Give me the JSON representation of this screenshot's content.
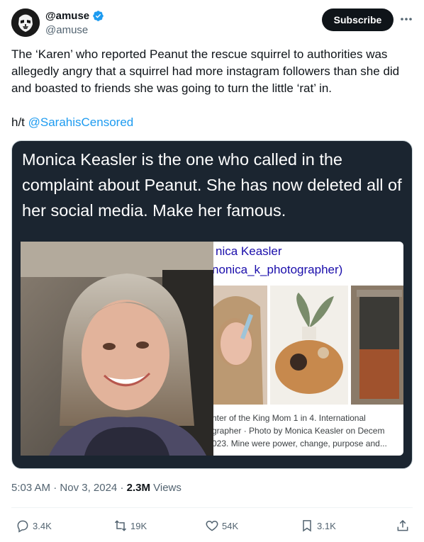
{
  "author": {
    "display_name": "@amuse",
    "handle": "@amuse",
    "verified_icon": "verified-badge-icon",
    "avatar_icon": "stormtrooper-avatar"
  },
  "header": {
    "subscribe_label": "Subscribe",
    "more_icon": "more-horizontal-icon"
  },
  "post": {
    "text": "The ‘Karen’ who reported Peanut the rescue squirrel to authorities was allegedly angry that a squirrel had more instagram followers than she did and boasted to friends she was going to turn the little ‘rat’ in.",
    "ht_prefix": "h/t ",
    "ht_mention": "@SarahisCensored"
  },
  "media": {
    "caption": "Monica Keasler is the one who called in the complaint about Peanut. She has now deleted all of her social media. Make her famous.",
    "screenshot": {
      "name": "nica Keasler",
      "handle": "nonica_k_photographer)",
      "desc_lines": [
        "nter of the King Mom 1 in 4. International",
        "grapher · Photo by Monica Keasler on Decem",
        "023. Mine were power, change, purpose and..."
      ]
    }
  },
  "meta": {
    "time": "5:03 AM",
    "separator": " · ",
    "date": "Nov 3, 2024",
    "views_count": "2.3M",
    "views_label": " Views"
  },
  "actions": {
    "replies": "3.4K",
    "reposts": "19K",
    "likes": "54K",
    "bookmarks": "3.1K"
  },
  "colors": {
    "accent": "#1d9bf0",
    "text": "#0f1419",
    "muted": "#536471",
    "media_bg": "#1b2530"
  }
}
